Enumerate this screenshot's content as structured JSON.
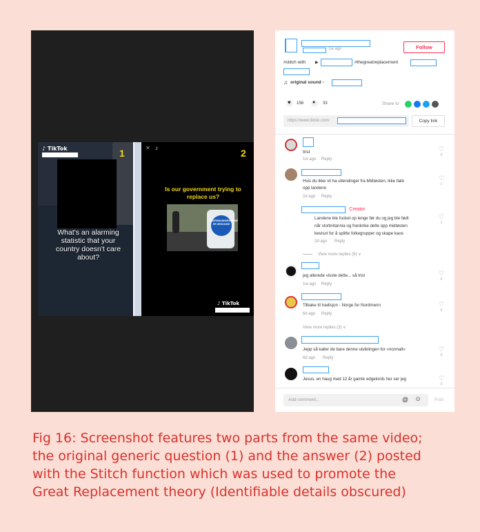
{
  "video": {
    "part1": {
      "brand": "♪ TikTok",
      "number": "1",
      "question": "What's an alarming statistic that your country doesn't care about?"
    },
    "part2": {
      "controls": "✕",
      "tiktok_glyph": "♪",
      "number": "2",
      "question": "Is our government trying to replace us?",
      "sticker_text": "NORDMANNSRASISME ER GENOCIDE",
      "brand": "♪ TikTok"
    }
  },
  "header": {
    "time_ago": "1w ago",
    "follow_label": "Follow",
    "stitch_prefix": "#stitch with",
    "play_glyph": "▶",
    "hashtag": "#thegreatreplacement",
    "sound_label": "original sound -",
    "music_glyph": "♫"
  },
  "stats": {
    "likes": "158",
    "comments": "33",
    "share_label": "Share to",
    "heart_glyph": "♥",
    "bubble_glyph": "●"
  },
  "link": {
    "url": "https://www.tiktok.com/",
    "copy_label": "Copy link"
  },
  "comments": [
    {
      "text": "trist",
      "time": "1w ago",
      "reply": "Reply",
      "likes": "9"
    },
    {
      "text_line1": "Hvis du ikke vil ha utlendinger fra Midtøsten, ikke fakk",
      "text_line2": "opp landene",
      "time": "2d ago",
      "reply": "Reply",
      "likes": "1"
    },
    {
      "creator_label": "· Creator",
      "text_line1": "Landene ble fucket op lenge før du og jeg ble født",
      "text_line2": "når storbritannia og frankrike delte opp midtøsten",
      "text_line3": "bevisst for å splitte folkegrupper og skape kaos",
      "time": "2d ago",
      "reply": "Reply",
      "likes": "1"
    },
    {
      "view_more": "View more replies (9) ∨"
    },
    {
      "text": "jeg allerede visste dette... så trist",
      "time": "1w ago",
      "reply": "Reply",
      "likes": "6"
    },
    {
      "text": "Tilbake til tradisjon - Norge for Nordmenn",
      "time": "6d ago",
      "reply": "Reply",
      "likes": "6"
    },
    {
      "view_more": "View more replies (3) ∨"
    },
    {
      "text": "Jepp så kaller de bare denne utviklingen for «normalt»",
      "time": "6d ago",
      "reply": "Reply",
      "likes": "9"
    },
    {
      "text": "Jesus, en haug med 12 år gamle edgelords her ser jeg",
      "likes": "3"
    }
  ],
  "footer": {
    "placeholder": "Add comment...",
    "at_glyph": "@",
    "emoji_glyph": "☺",
    "post_label": "Post"
  },
  "caption": {
    "line1": "Fig 16: Screenshot features two parts from the same video;",
    "line2": "the original generic question (1) and the answer (2) posted",
    "line3": "with the Stitch function which was used to promote the",
    "line4": "Great Replacement theory (Identifiable details obscured)"
  },
  "colors": {
    "background": "#fbded5",
    "accent": "#fe2c55",
    "caption": "#d8322e",
    "highlight": "#f5d90a",
    "redaction_box": "#3a9ff2"
  },
  "icons": [
    "tiktok-logo-icon",
    "heart-icon",
    "comment-icon",
    "whatsapp-icon",
    "facebook-icon",
    "twitter-icon",
    "embed-icon",
    "music-note-icon",
    "mention-icon",
    "emoji-icon"
  ]
}
